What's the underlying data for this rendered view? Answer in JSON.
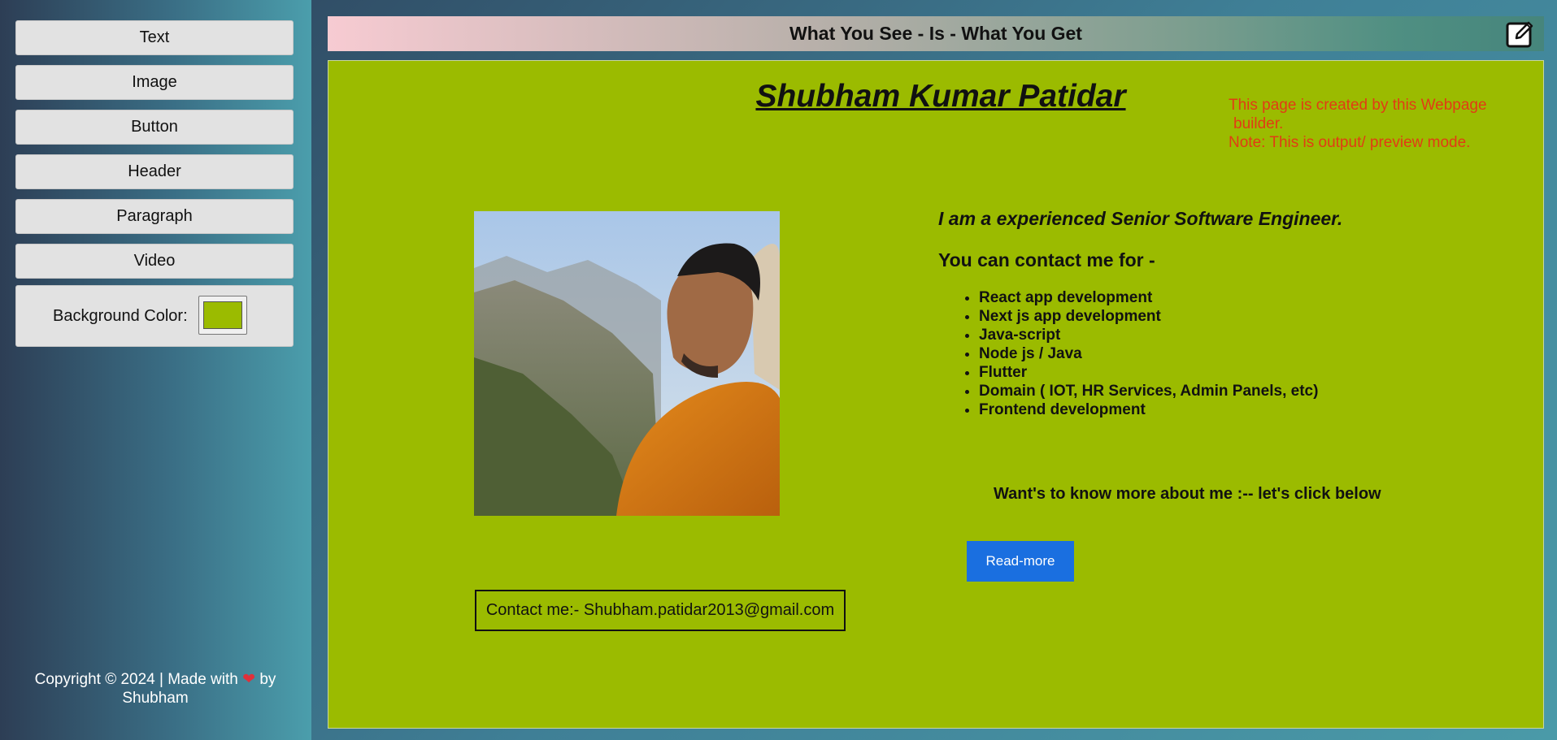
{
  "sidebar": {
    "tools": [
      {
        "label": "Text"
      },
      {
        "label": "Image"
      },
      {
        "label": "Button"
      },
      {
        "label": "Header"
      },
      {
        "label": "Paragraph"
      },
      {
        "label": "Video"
      }
    ],
    "background_label": "Background Color:",
    "background_value": "#9bbb00",
    "copyright_prefix": "Copyright © 2024 | Made with",
    "copyright_suffix": "by",
    "copyright_author": "Shubham",
    "heart_icon": "heart-icon"
  },
  "header": {
    "title": "What You See - Is - What You Get",
    "edit_icon": "edit-icon"
  },
  "canvas": {
    "background": "#9bbb00",
    "title": "Shubham Kumar Patidar",
    "note_line1": "This page is created by this Webpage",
    "note_line2": "builder.",
    "note_line3": "Note: This is output/ preview mode.",
    "intro": "I am a experienced Senior Software Engineer.",
    "contact_heading": "You can contact me for -",
    "skills": [
      "React app development",
      "Next js app development",
      "Java-script",
      "Node js / Java",
      "Flutter",
      "Domain ( IOT, HR Services, Admin Panels, etc)",
      "Frontend development"
    ],
    "cta": "Want's to know more about me :-- let's click below",
    "read_more_label": "Read-more",
    "contact": "Contact me:- Shubham.patidar2013@gmail.com"
  },
  "colors": {
    "accent_button": "#1a6fe0",
    "note_text": "#e23b14"
  }
}
